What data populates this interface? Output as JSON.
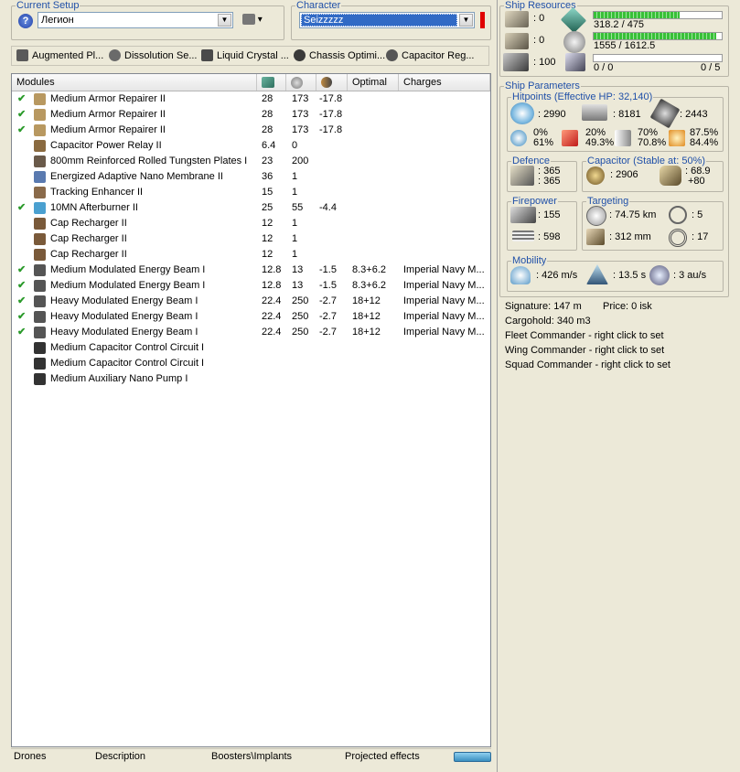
{
  "setup": {
    "legend": "Current Setup",
    "ship_name": "Легион"
  },
  "character": {
    "legend": "Character",
    "name": "Seizzzzz"
  },
  "implants": [
    {
      "label": "Augmented Pl...",
      "icon": "implant-icon"
    },
    {
      "label": "Dissolution Se...",
      "icon": "implant-icon"
    },
    {
      "label": "Liquid Crystal ...",
      "icon": "implant-icon"
    },
    {
      "label": "Chassis Optimi...",
      "icon": "implant-icon"
    },
    {
      "label": "Capacitor Reg...",
      "icon": "implant-icon"
    }
  ],
  "columns": {
    "modules": "Modules",
    "optimal": "Optimal",
    "charges": "Charges"
  },
  "modules": [
    {
      "active": true,
      "name": "Medium Armor Repairer II",
      "cpu": "28",
      "pg": "173",
      "cap": "-17.8",
      "optimal": "",
      "charges": ""
    },
    {
      "active": true,
      "name": "Medium Armor Repairer II",
      "cpu": "28",
      "pg": "173",
      "cap": "-17.8",
      "optimal": "",
      "charges": ""
    },
    {
      "active": true,
      "name": "Medium Armor Repairer II",
      "cpu": "28",
      "pg": "173",
      "cap": "-17.8",
      "optimal": "",
      "charges": ""
    },
    {
      "active": false,
      "name": "Capacitor Power Relay II",
      "cpu": "6.4",
      "pg": "0",
      "cap": "",
      "optimal": "",
      "charges": ""
    },
    {
      "active": false,
      "name": "800mm Reinforced Rolled Tungsten Plates I",
      "cpu": "23",
      "pg": "200",
      "cap": "",
      "optimal": "",
      "charges": ""
    },
    {
      "active": false,
      "name": "Energized Adaptive Nano Membrane II",
      "cpu": "36",
      "pg": "1",
      "cap": "",
      "optimal": "",
      "charges": ""
    },
    {
      "active": false,
      "name": "Tracking Enhancer II",
      "cpu": "15",
      "pg": "1",
      "cap": "",
      "optimal": "",
      "charges": ""
    },
    {
      "active": true,
      "name": "10MN Afterburner II",
      "cpu": "25",
      "pg": "55",
      "cap": "-4.4",
      "optimal": "",
      "charges": ""
    },
    {
      "active": false,
      "name": "Cap Recharger II",
      "cpu": "12",
      "pg": "1",
      "cap": "",
      "optimal": "",
      "charges": ""
    },
    {
      "active": false,
      "name": "Cap Recharger II",
      "cpu": "12",
      "pg": "1",
      "cap": "",
      "optimal": "",
      "charges": ""
    },
    {
      "active": false,
      "name": "Cap Recharger II",
      "cpu": "12",
      "pg": "1",
      "cap": "",
      "optimal": "",
      "charges": ""
    },
    {
      "active": true,
      "name": "Medium Modulated Energy Beam I",
      "cpu": "12.8",
      "pg": "13",
      "cap": "-1.5",
      "optimal": "8.3+6.2",
      "charges": "Imperial Navy M..."
    },
    {
      "active": true,
      "name": "Medium Modulated Energy Beam I",
      "cpu": "12.8",
      "pg": "13",
      "cap": "-1.5",
      "optimal": "8.3+6.2",
      "charges": "Imperial Navy M..."
    },
    {
      "active": true,
      "name": "Heavy Modulated Energy Beam I",
      "cpu": "22.4",
      "pg": "250",
      "cap": "-2.7",
      "optimal": "18+12",
      "charges": "Imperial Navy M..."
    },
    {
      "active": true,
      "name": "Heavy Modulated Energy Beam I",
      "cpu": "22.4",
      "pg": "250",
      "cap": "-2.7",
      "optimal": "18+12",
      "charges": "Imperial Navy M..."
    },
    {
      "active": true,
      "name": "Heavy Modulated Energy Beam I",
      "cpu": "22.4",
      "pg": "250",
      "cap": "-2.7",
      "optimal": "18+12",
      "charges": "Imperial Navy M..."
    },
    {
      "active": false,
      "name": "Medium Capacitor Control Circuit I",
      "cpu": "",
      "pg": "",
      "cap": "",
      "optimal": "",
      "charges": ""
    },
    {
      "active": false,
      "name": "Medium Capacitor Control Circuit I",
      "cpu": "",
      "pg": "",
      "cap": "",
      "optimal": "",
      "charges": ""
    },
    {
      "active": false,
      "name": "Medium Auxiliary Nano Pump I",
      "cpu": "",
      "pg": "",
      "cap": "",
      "optimal": "",
      "charges": ""
    }
  ],
  "tabs": [
    "Drones",
    "Description",
    "Boosters\\Implants",
    "Projected effects"
  ],
  "resources": {
    "legend": "Ship Resources",
    "turrets": ": 0",
    "launchers": ": 0",
    "calibration": ": 100",
    "cpu_text": "318.2 / 475",
    "cpu_fraction": 0.67,
    "pg_text": "1555 / 1612.5",
    "pg_fraction": 0.96,
    "drone_bw": "0 / 0",
    "drones": "0 / 5"
  },
  "params": {
    "legend": "Ship Parameters",
    "hp_legend": "Hitpoints (Effective HP: 32,140)",
    "shield_hp": ": 2990",
    "armor_hp": ": 8181",
    "structure_hp": ": 2443",
    "res": [
      {
        "a": "0%",
        "b": "61%"
      },
      {
        "a": "20%",
        "b": "49.3%"
      },
      {
        "a": "70%",
        "b": "70.8%"
      },
      {
        "a": "87.5%",
        "b": "84.4%"
      }
    ],
    "defence_legend": "Defence",
    "defence_a": ": 365",
    "defence_b": ": 365",
    "cap_legend": "Capacitor (Stable at: 50%)",
    "cap_amount": ": 2906",
    "cap_delta_a": ": 68.9",
    "cap_delta_b": "+80",
    "firepower_legend": "Firepower",
    "dps": ": 155",
    "volley": ": 598",
    "targeting_legend": "Targeting",
    "range": ": 74.75 km",
    "targets": ": 5",
    "scan_res": ": 312 mm",
    "sensor": ": 17",
    "mobility_legend": "Mobility",
    "speed": ": 426 m/s",
    "align": ": 13.5 s",
    "warp": ": 3 au/s",
    "signature": "Signature: 147 m",
    "price": "Price: 0 isk",
    "cargohold": "Cargohold: 340 m3",
    "fleet_cmd": "Fleet Commander - right click to set",
    "wing_cmd": "Wing Commander - right click to set",
    "squad_cmd": "Squad Commander - right click to set"
  }
}
